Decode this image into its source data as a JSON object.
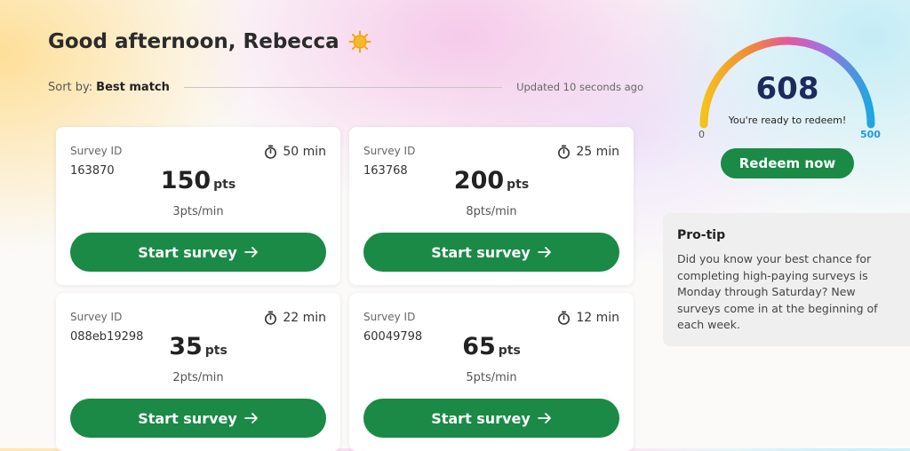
{
  "greeting": "Good afternoon, Rebecca",
  "sort": {
    "label": "Sort by:",
    "value": "Best match",
    "updated": "Updated 10 seconds ago"
  },
  "surveys": [
    {
      "id_label": "Survey ID",
      "id": "163870",
      "time": "50 min",
      "points": "150",
      "unit": "pts",
      "rate": "3pts/min",
      "button": "Start survey"
    },
    {
      "id_label": "Survey ID",
      "id": "163768",
      "time": "25 min",
      "points": "200",
      "unit": "pts",
      "rate": "8pts/min",
      "button": "Start survey"
    },
    {
      "id_label": "Survey ID",
      "id": "088eb19298",
      "time": "22 min",
      "points": "35",
      "unit": "pts",
      "rate": "2pts/min",
      "button": "Start survey"
    },
    {
      "id_label": "Survey ID",
      "id": "60049798",
      "time": "12 min",
      "points": "65",
      "unit": "pts",
      "rate": "5pts/min",
      "button": "Start survey"
    }
  ],
  "gauge": {
    "score": "608",
    "message": "You're ready to redeem!",
    "min": "0",
    "max": "500",
    "level": 1.0
  },
  "redeem_button": "Redeem now",
  "protip": {
    "title": "Pro-tip",
    "body": "Did you know your best chance for completing high-paying surveys is Monday through Saturday? New surveys come in at the beginning of each week."
  },
  "colors": {
    "accent_green": "#1a8a46",
    "score_navy": "#1d2a5c"
  },
  "icons": {
    "greeting": "sun-icon",
    "time": "stopwatch-icon",
    "button": "arrow-right-icon"
  }
}
